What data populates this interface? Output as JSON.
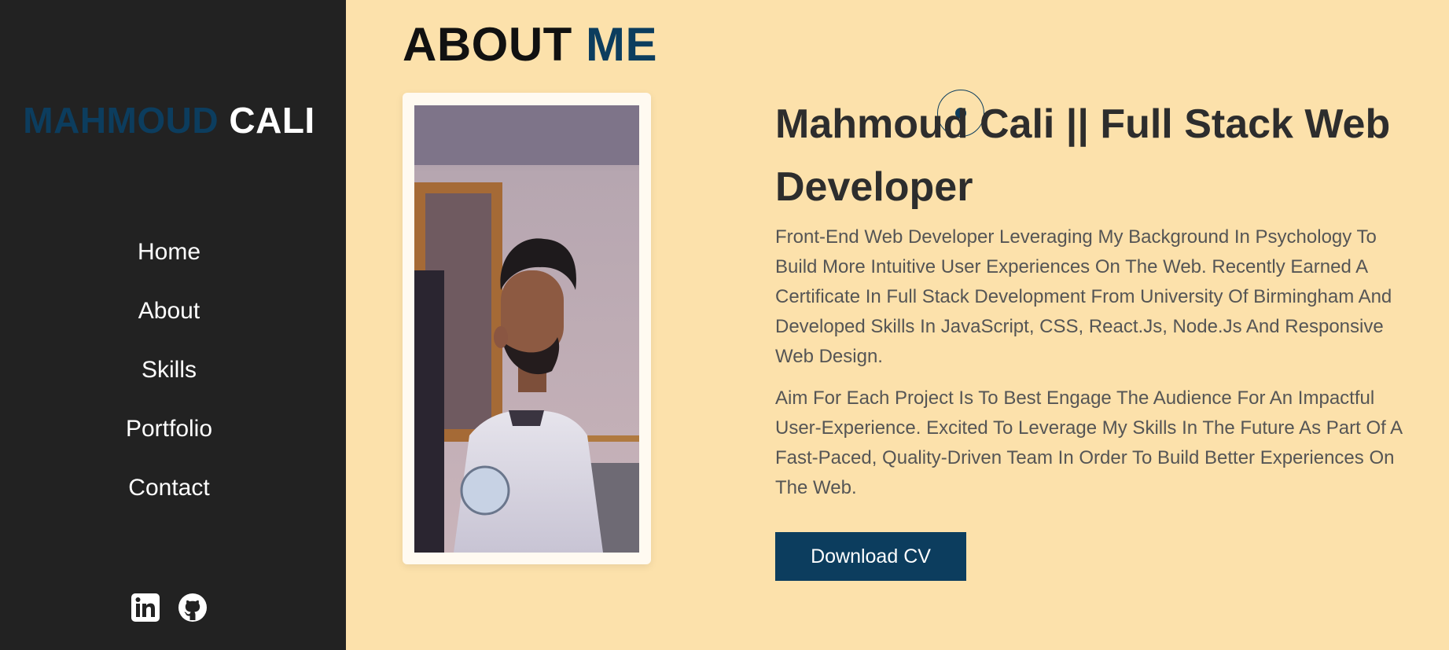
{
  "sidebar": {
    "logo": {
      "first": "MAHMOUD",
      "last": "CALI"
    },
    "nav": [
      {
        "label": "Home"
      },
      {
        "label": "About"
      },
      {
        "label": "Skills"
      },
      {
        "label": "Portfolio"
      },
      {
        "label": "Contact"
      }
    ],
    "social": [
      {
        "icon": "linkedin-icon"
      },
      {
        "icon": "github-icon"
      }
    ]
  },
  "about": {
    "title_main": "ABOUT",
    "title_accent": "ME",
    "headline": "Mahmoud Cali || Full Stack Web Developer",
    "paragraph_1": "Front-End Web Developer Leveraging My Background In Psychology To Build More Intuitive User Experiences On The Web. Recently Earned A Certificate In Full Stack Development From University Of Birmingham And Developed Skills In JavaScript, CSS, React.Js, Node.Js And Responsive Web Design.",
    "paragraph_2": "Aim For Each Project Is To Best Engage The Audience For An Impactful User-Experience. Excited To Leverage My Skills In The Future As Part Of A Fast-Paced, Quality-Driven Team In Order To Build Better Experiences On The Web.",
    "download_cv": "Download CV"
  },
  "colors": {
    "accent": "#0c3d5e",
    "sidebar_bg": "#222222",
    "page_bg": "#fce1ab"
  }
}
